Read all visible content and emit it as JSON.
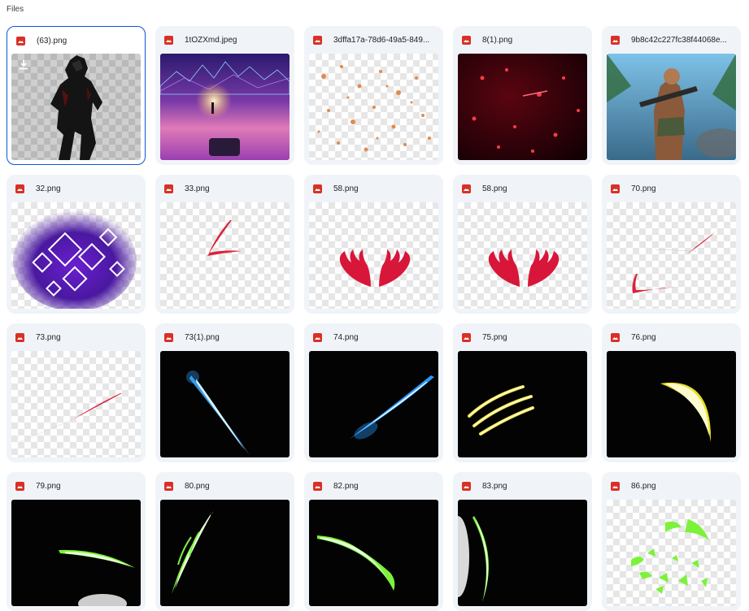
{
  "section_title": "Files",
  "files": [
    {
      "name": "(63).png",
      "selected": true
    },
    {
      "name": "1tOZXmd.jpeg"
    },
    {
      "name": "3dffa17a-78d6-49a5-849..."
    },
    {
      "name": "8(1).png"
    },
    {
      "name": "9b8c42c227fc38f44068e..."
    },
    {
      "name": "32.png"
    },
    {
      "name": "33.png"
    },
    {
      "name": "58.png"
    },
    {
      "name": "58.png"
    },
    {
      "name": "70.png"
    },
    {
      "name": "73.png"
    },
    {
      "name": "73(1).png"
    },
    {
      "name": "74.png"
    },
    {
      "name": "75.png"
    },
    {
      "name": "76.png"
    },
    {
      "name": "79.png"
    },
    {
      "name": "80.png"
    },
    {
      "name": "82.png"
    },
    {
      "name": "83.png"
    },
    {
      "name": "86.png"
    }
  ],
  "icons": {
    "file_type": "image-file-icon",
    "download": "download-icon"
  },
  "colors": {
    "selected_border": "#0b57d0",
    "file_icon": "#d93025",
    "card_bg": "#f0f4f9"
  }
}
